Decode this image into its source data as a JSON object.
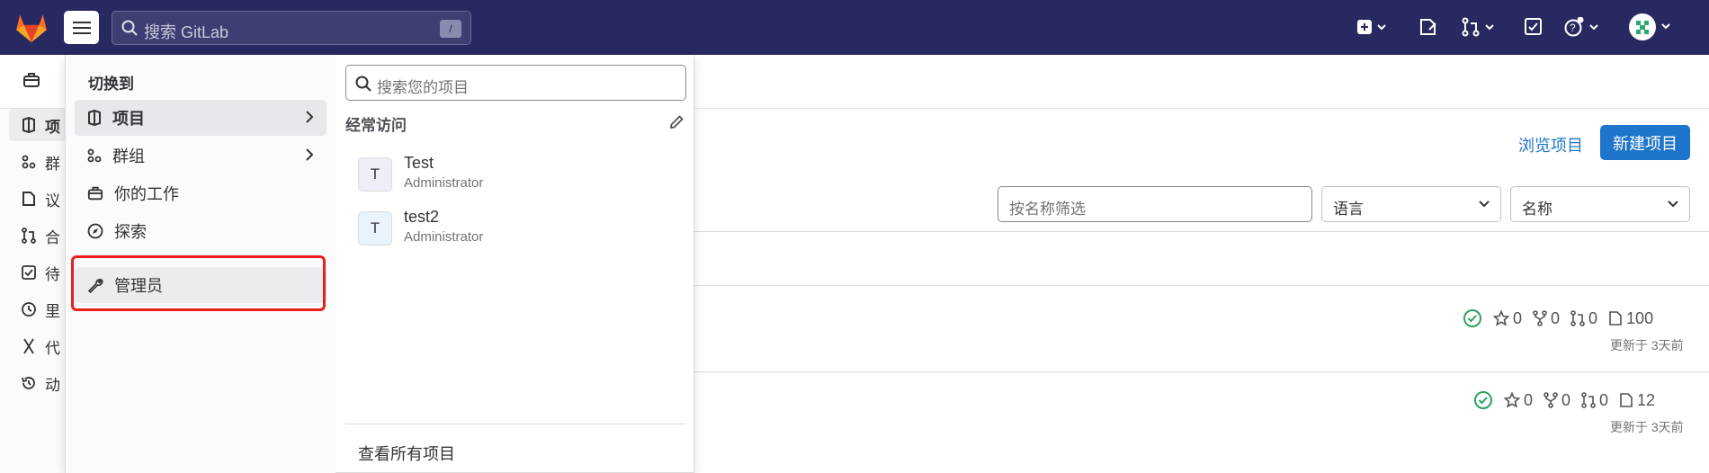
{
  "topbar": {
    "search_placeholder": "搜索 GitLab",
    "search_shortcut": "/",
    "icons": [
      "gitlab-logo",
      "menu-icon",
      "plus-square-icon",
      "issues-icon",
      "merge-request-icon",
      "todo-icon",
      "help-icon",
      "avatar"
    ],
    "bg_color": "#292961"
  },
  "sidebar": {
    "items": [
      {
        "label": "项",
        "icon": "project-icon"
      },
      {
        "label": "群",
        "icon": "group-icon"
      },
      {
        "label": "议",
        "icon": "issues-icon"
      },
      {
        "label": "合",
        "icon": "merge-request-icon"
      },
      {
        "label": "待",
        "icon": "todo-icon"
      },
      {
        "label": "里",
        "icon": "clock-icon"
      },
      {
        "label": "代",
        "icon": "snippet-icon"
      },
      {
        "label": "动",
        "icon": "history-icon"
      }
    ]
  },
  "main": {
    "browse_label": "浏览项目",
    "new_project_label": "新建项目",
    "filter_placeholder": "按名称筛选",
    "language_select": "语言",
    "sort_select": "名称",
    "rows": [
      {
        "stars": "0",
        "forks": "0",
        "mrs": "0",
        "issues": "100",
        "updated": "更新于 3天前"
      },
      {
        "stars": "0",
        "forks": "0",
        "mrs": "0",
        "issues": "12",
        "updated": "更新于 3天前"
      }
    ],
    "accent_color": "#1f75cb"
  },
  "menu": {
    "switch_title": "切换到",
    "items": [
      {
        "label": "项目",
        "icon": "project-icon",
        "has_arrow": true
      },
      {
        "label": "群组",
        "icon": "group-icon",
        "has_arrow": true
      },
      {
        "label": "你的工作",
        "icon": "briefcase-icon",
        "has_arrow": false
      },
      {
        "label": "探索",
        "icon": "compass-icon",
        "has_arrow": false
      },
      {
        "label": "管理员",
        "icon": "wrench-icon",
        "has_arrow": false
      }
    ],
    "project_search_placeholder": "搜索您的项目",
    "frequent_title": "经常访问",
    "projects": [
      {
        "initial": "T",
        "name": "Test",
        "owner": "Administrator"
      },
      {
        "initial": "T",
        "name": "test2",
        "owner": "Administrator"
      }
    ],
    "view_all_label": "查看所有项目",
    "highlight_color": "#e8201a"
  }
}
